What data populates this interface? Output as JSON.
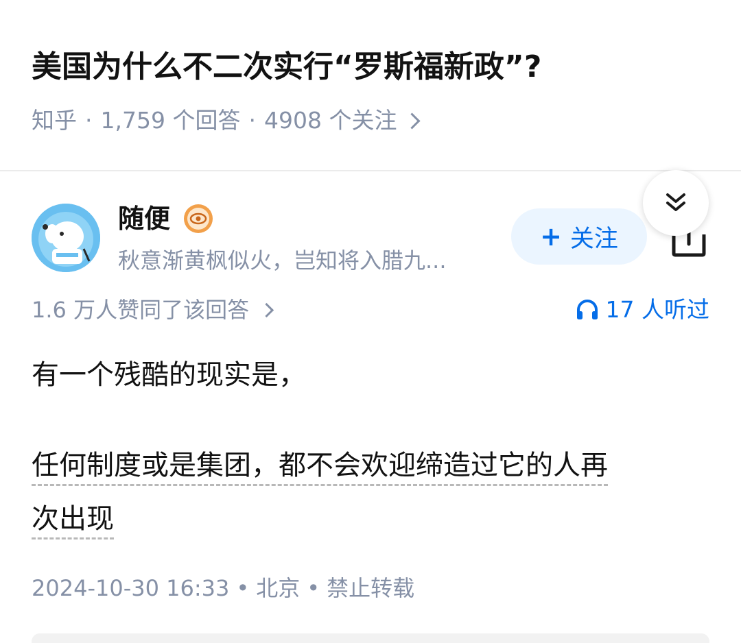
{
  "question": {
    "title": "美国为什么不二次实行“罗斯福新政”?",
    "source": "知乎",
    "answers": "1,759 个回答",
    "followers": "4908 个关注"
  },
  "author": {
    "name": "随便",
    "bio": "秋意渐黄枫似火，岂知将入腊九...",
    "badge_icon": "eye-badge-icon"
  },
  "actions": {
    "follow_label": "关注",
    "collapse_icon": "double-chevron-down-icon",
    "share_icon": "share-icon"
  },
  "answer_meta": {
    "votes": "1.6 万人赞同了该回答",
    "listen": "17 人听过"
  },
  "answer": {
    "paragraph1": "有一个残酷的现实是，",
    "paragraph2_line1": "任何制度或是集团，都不会欢迎缔造过它的人再",
    "paragraph2_line2": "次出现"
  },
  "footer": {
    "date": "2024-10-30 16:33",
    "location": "北京",
    "copyright": "禁止转载"
  },
  "colors": {
    "accent": "#056de8",
    "muted": "#8590a6",
    "follow_bg": "#ebf5ff"
  }
}
